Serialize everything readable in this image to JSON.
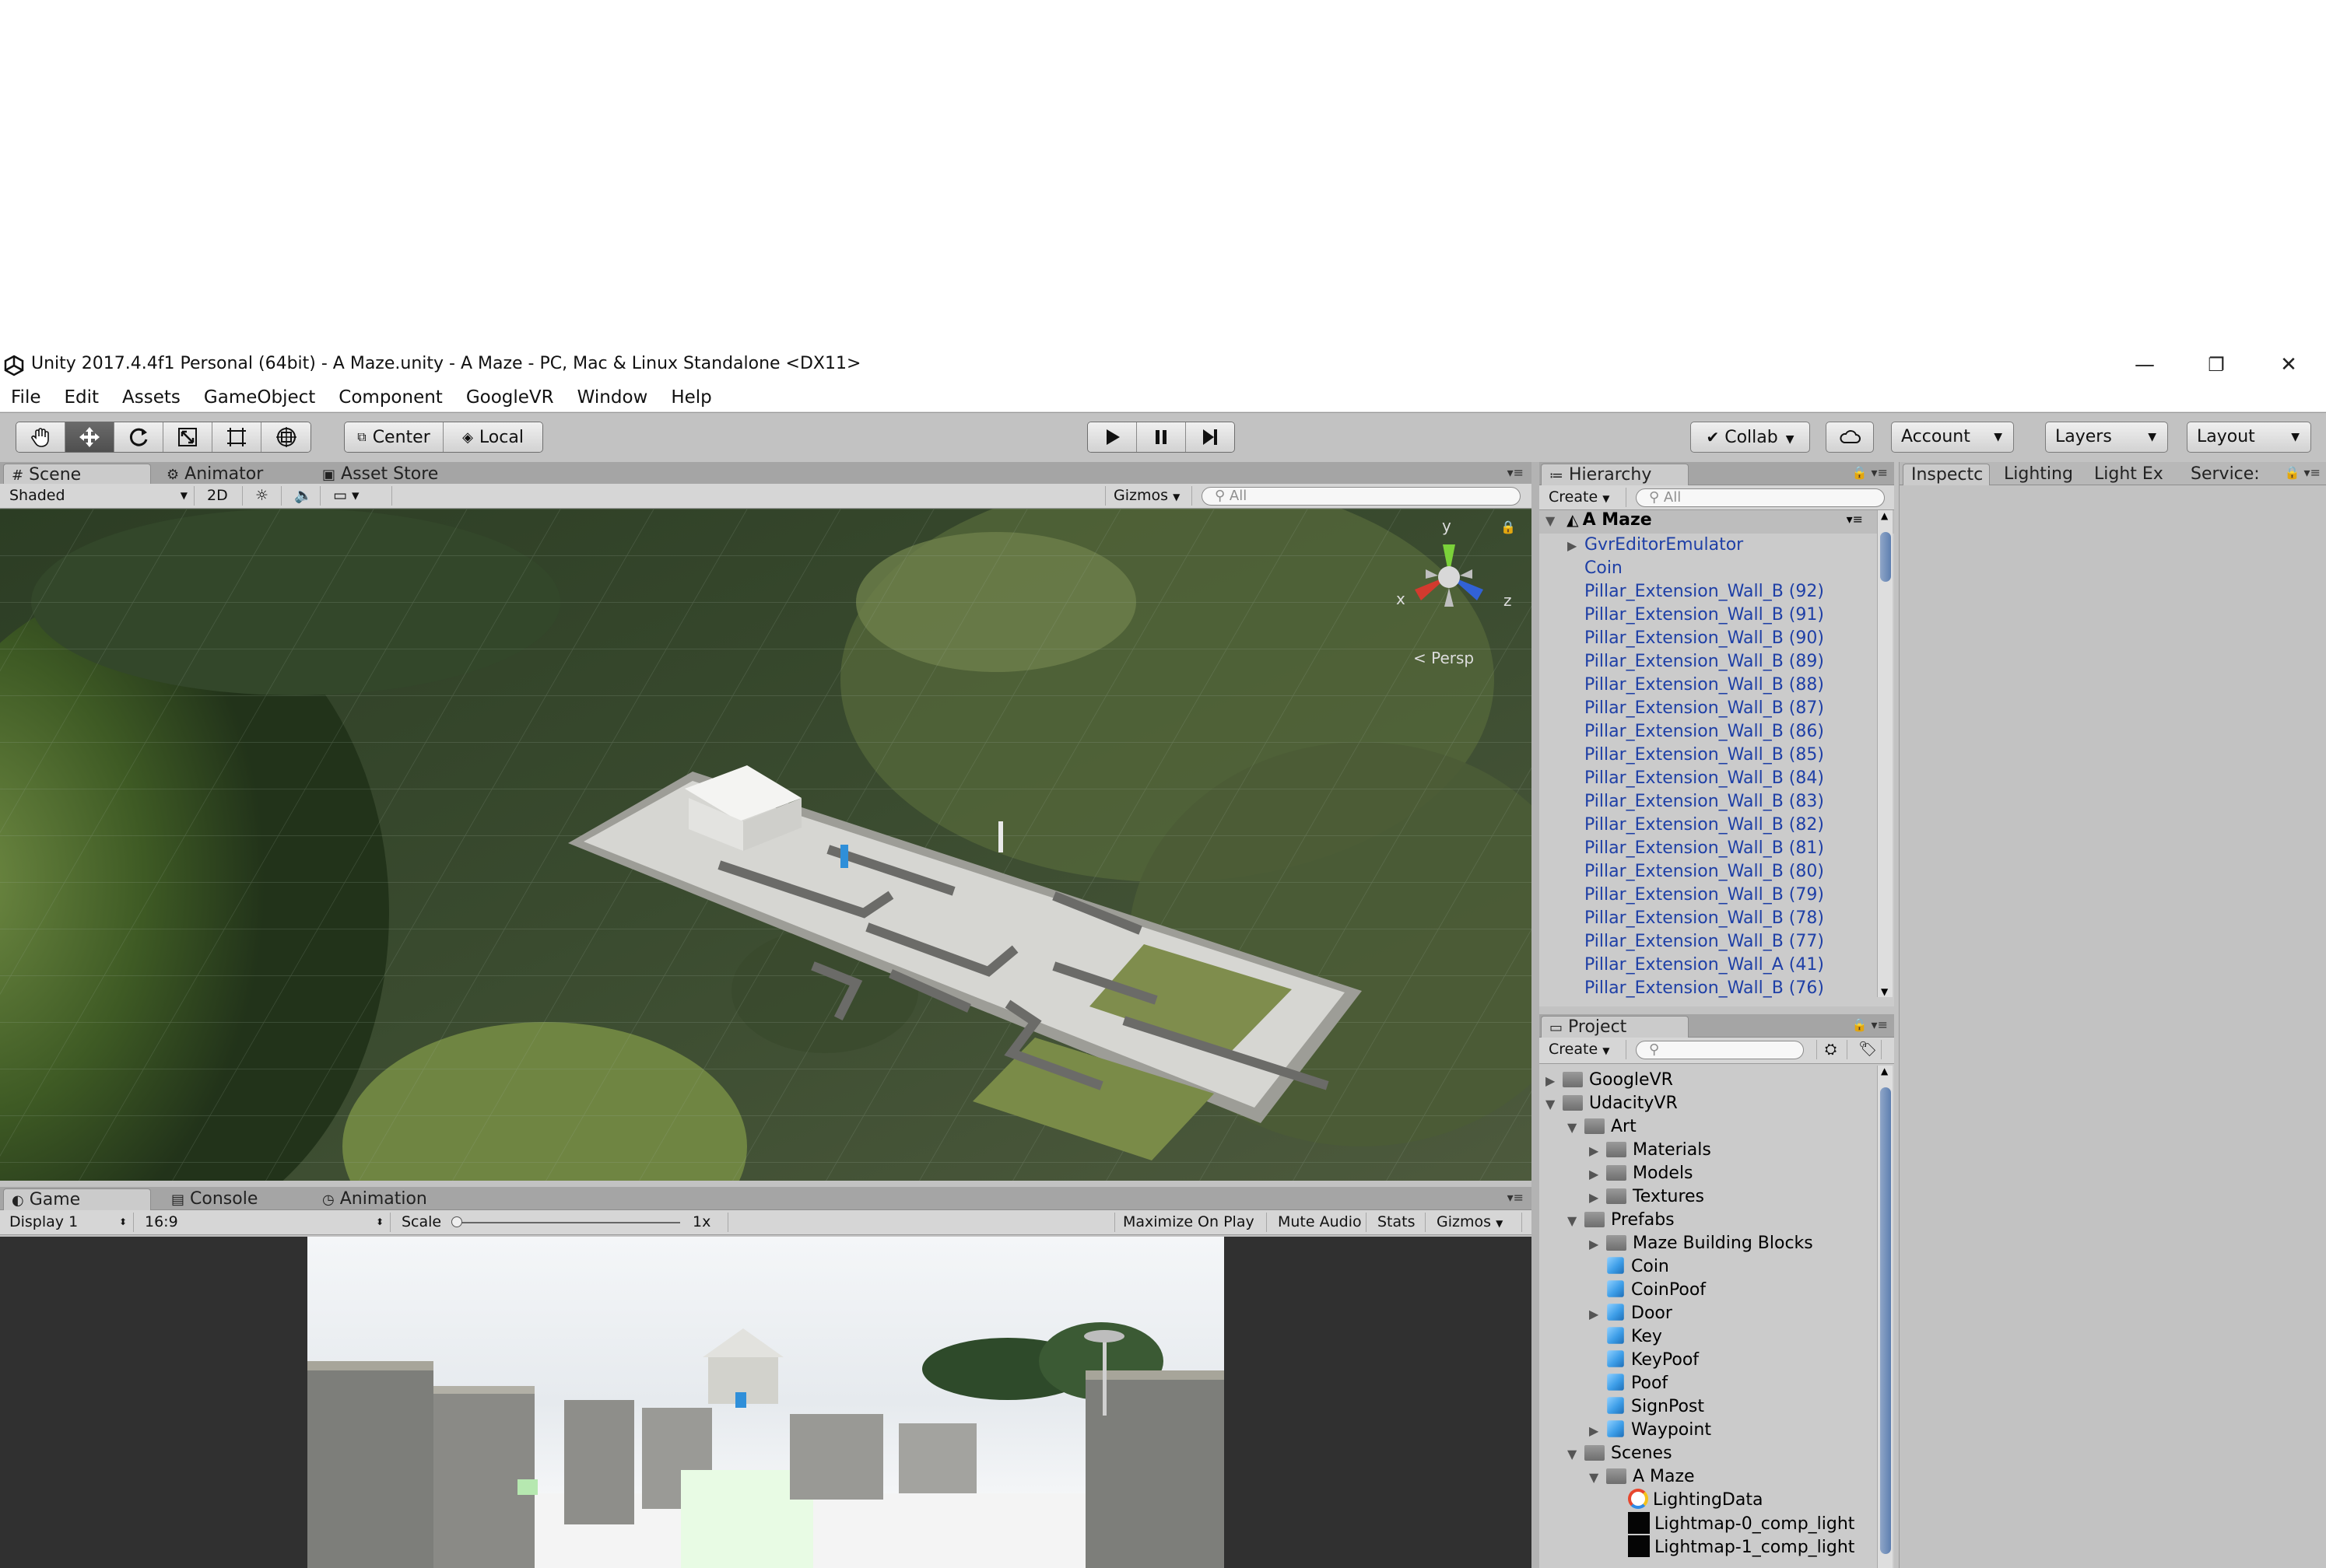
{
  "window": {
    "title": "Unity 2017.4.4f1 Personal (64bit) - A Maze.unity - A Maze - PC, Mac & Linux Standalone <DX11>",
    "controls": {
      "minimize": "—",
      "restore": "❐",
      "close": "✕"
    }
  },
  "menu": [
    "File",
    "Edit",
    "Assets",
    "GameObject",
    "Component",
    "GoogleVR",
    "Window",
    "Help"
  ],
  "toolbar": {
    "transform_tools": [
      "hand-tool",
      "move-tool",
      "rotate-tool",
      "scale-tool",
      "rect-tool",
      "transform-tool"
    ],
    "pivot": "Center",
    "space": "Local",
    "play_controls": {
      "play": "▶",
      "pause": "⏸",
      "step": "⏭"
    },
    "collab": "Collab",
    "account": "Account",
    "layers": "Layers",
    "layout": "Layout"
  },
  "scene_panel": {
    "tabs": [
      "Scene",
      "Animator",
      "Asset Store"
    ],
    "shading": "Shaded",
    "mode_2d": "2D",
    "gizmos": "Gizmos",
    "search_placeholder": "All",
    "axis": {
      "y": "y",
      "x": "x",
      "z": "z"
    },
    "projection": "< Persp"
  },
  "game_panel": {
    "tabs": [
      "Game",
      "Console",
      "Animation"
    ],
    "display": "Display 1",
    "aspect": "16:9",
    "scale_label": "Scale",
    "scale_value": "1x",
    "toggles": [
      "Maximize On Play",
      "Mute Audio",
      "Stats",
      "Gizmos"
    ]
  },
  "hierarchy": {
    "tab": "Hierarchy",
    "create": "Create",
    "search_placeholder": "All",
    "scene_name": "A Maze",
    "items": [
      "GvrEditorEmulator",
      "Coin",
      "Pillar_Extension_Wall_B (92)",
      "Pillar_Extension_Wall_B (91)",
      "Pillar_Extension_Wall_B (90)",
      "Pillar_Extension_Wall_B (89)",
      "Pillar_Extension_Wall_B (88)",
      "Pillar_Extension_Wall_B (87)",
      "Pillar_Extension_Wall_B (86)",
      "Pillar_Extension_Wall_B (85)",
      "Pillar_Extension_Wall_B (84)",
      "Pillar_Extension_Wall_B (83)",
      "Pillar_Extension_Wall_B (82)",
      "Pillar_Extension_Wall_B (81)",
      "Pillar_Extension_Wall_B (80)",
      "Pillar_Extension_Wall_B (79)",
      "Pillar_Extension_Wall_B (78)",
      "Pillar_Extension_Wall_B (77)",
      "Pillar_Extension_Wall_A (41)",
      "Pillar_Extension_Wall_B (76)"
    ]
  },
  "project": {
    "tab": "Project",
    "create": "Create",
    "tree": [
      {
        "label": "GoogleVR",
        "depth": 0,
        "icon": "folder",
        "arrow": "▶"
      },
      {
        "label": "UdacityVR",
        "depth": 0,
        "icon": "folder",
        "arrow": "▼"
      },
      {
        "label": "Art",
        "depth": 1,
        "icon": "folder",
        "arrow": "▼"
      },
      {
        "label": "Materials",
        "depth": 2,
        "icon": "folder",
        "arrow": "▶"
      },
      {
        "label": "Models",
        "depth": 2,
        "icon": "folder",
        "arrow": "▶"
      },
      {
        "label": "Textures",
        "depth": 2,
        "icon": "folder",
        "arrow": "▶"
      },
      {
        "label": "Prefabs",
        "depth": 1,
        "icon": "folder",
        "arrow": "▼"
      },
      {
        "label": "Maze Building Blocks",
        "depth": 2,
        "icon": "folder",
        "arrow": "▶"
      },
      {
        "label": "Coin",
        "depth": 2,
        "icon": "prefab",
        "arrow": ""
      },
      {
        "label": "CoinPoof",
        "depth": 2,
        "icon": "prefab",
        "arrow": ""
      },
      {
        "label": "Door",
        "depth": 2,
        "icon": "prefab",
        "arrow": "▶"
      },
      {
        "label": "Key",
        "depth": 2,
        "icon": "prefab",
        "arrow": ""
      },
      {
        "label": "KeyPoof",
        "depth": 2,
        "icon": "prefab",
        "arrow": ""
      },
      {
        "label": "Poof",
        "depth": 2,
        "icon": "prefab",
        "arrow": ""
      },
      {
        "label": "SignPost",
        "depth": 2,
        "icon": "prefab",
        "arrow": ""
      },
      {
        "label": "Waypoint",
        "depth": 2,
        "icon": "prefab",
        "arrow": "▶"
      },
      {
        "label": "Scenes",
        "depth": 1,
        "icon": "folder",
        "arrow": "▼"
      },
      {
        "label": "A Maze",
        "depth": 2,
        "icon": "folder",
        "arrow": "▼"
      },
      {
        "label": "LightingData",
        "depth": 3,
        "icon": "lighting",
        "arrow": ""
      },
      {
        "label": "Lightmap-0_comp_light",
        "depth": 3,
        "icon": "lightmap",
        "arrow": ""
      },
      {
        "label": "Lightmap-1_comp_light",
        "depth": 3,
        "icon": "lightmap",
        "arrow": ""
      }
    ]
  },
  "inspector": {
    "tabs": [
      "Inspectc",
      "Lighting",
      "Light Ex",
      "Service:"
    ]
  },
  "colors": {
    "hierarchy_text": "#1e3fa6",
    "editor_bg": "#c2c2c2",
    "accent_scroll": "#5e7fb0"
  }
}
